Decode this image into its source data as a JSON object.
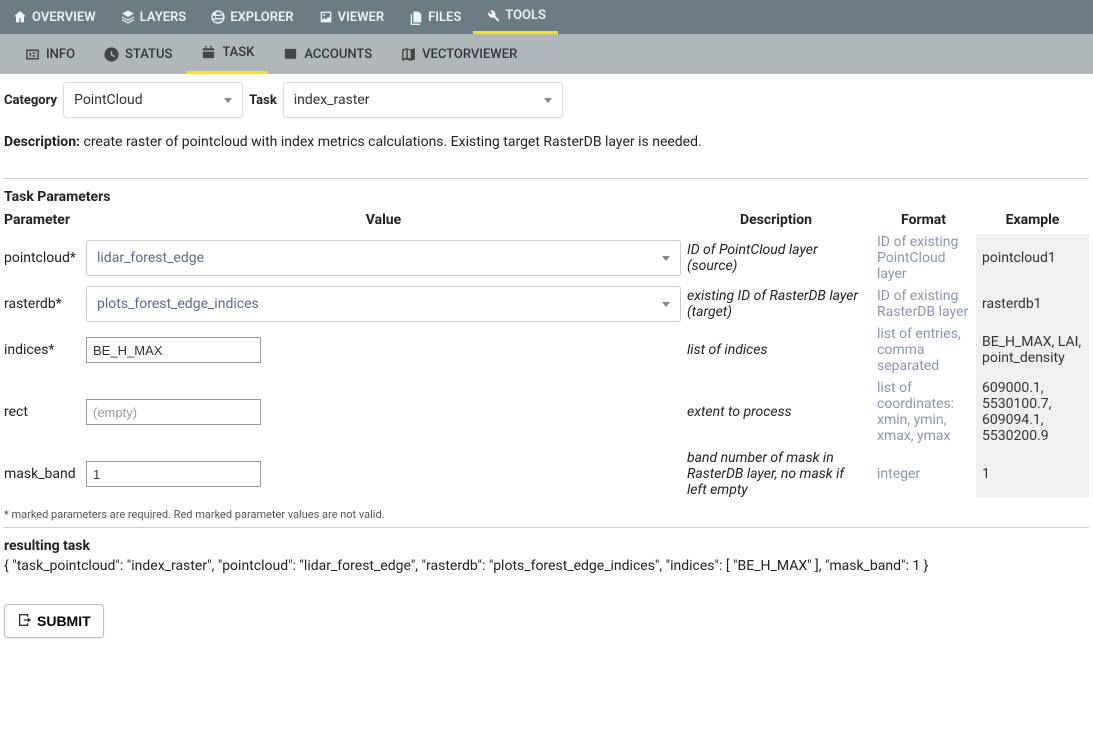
{
  "topnav": [
    {
      "label": "OVERVIEW",
      "icon": "home"
    },
    {
      "label": "LAYERS",
      "icon": "layers"
    },
    {
      "label": "EXPLORER",
      "icon": "globe"
    },
    {
      "label": "VIEWER",
      "icon": "image"
    },
    {
      "label": "FILES",
      "icon": "files"
    },
    {
      "label": "TOOLS",
      "icon": "wrench",
      "active": true
    }
  ],
  "subnav": [
    {
      "label": "INFO",
      "icon": "info"
    },
    {
      "label": "STATUS",
      "icon": "clock"
    },
    {
      "label": "TASK",
      "icon": "task",
      "active": true
    },
    {
      "label": "ACCOUNTS",
      "icon": "accounts"
    },
    {
      "label": "VECTORVIEWER",
      "icon": "map"
    }
  ],
  "selectors": {
    "category_label": "Category",
    "category_value": "PointCloud",
    "task_label": "Task",
    "task_value": "index_raster"
  },
  "description": {
    "label": "Description:",
    "text": "create raster of pointcloud with index metrics calculations. Existing target RasterDB layer is needed."
  },
  "params_title": "Task Parameters",
  "headers": {
    "param": "Parameter",
    "value": "Value",
    "desc": "Description",
    "fmt": "Format",
    "ex": "Example"
  },
  "params": [
    {
      "name": "pointcloud*",
      "type": "select",
      "value": "lidar_forest_edge",
      "desc": "ID of PointCloud layer (source)",
      "fmt": "ID of existing PointCloud layer",
      "ex": "pointcloud1"
    },
    {
      "name": "rasterdb*",
      "type": "select",
      "value": "plots_forest_edge_indices",
      "desc": "existing ID of RasterDB layer (target)",
      "fmt": "ID of existing RasterDB layer",
      "ex": "rasterdb1"
    },
    {
      "name": "indices*",
      "type": "text",
      "value": "BE_H_MAX",
      "desc": "list of indices",
      "fmt": "list of entries, comma separated",
      "ex": "BE_H_MAX, LAI, point_density"
    },
    {
      "name": "rect",
      "type": "text",
      "value": "",
      "placeholder": "(empty)",
      "desc": "extent to process",
      "fmt": "list of coordinates: xmin, ymin, xmax, ymax",
      "ex": "609000.1, 5530100.7, 609094.1, 5530200.9"
    },
    {
      "name": "mask_band",
      "type": "text",
      "value": "1",
      "desc": "band number of mask in RasterDB layer, no mask if left empty",
      "fmt": "integer",
      "ex": "1"
    }
  ],
  "footnote": "* marked parameters are required. Red marked parameter values are not valid.",
  "result_label": "resulting task",
  "result_json": "{ \"task_pointcloud\": \"index_raster\", \"pointcloud\": \"lidar_forest_edge\", \"rasterdb\": \"plots_forest_edge_indices\", \"indices\": [ \"BE_H_MAX\" ], \"mask_band\": 1 }",
  "submit_label": "SUBMIT"
}
